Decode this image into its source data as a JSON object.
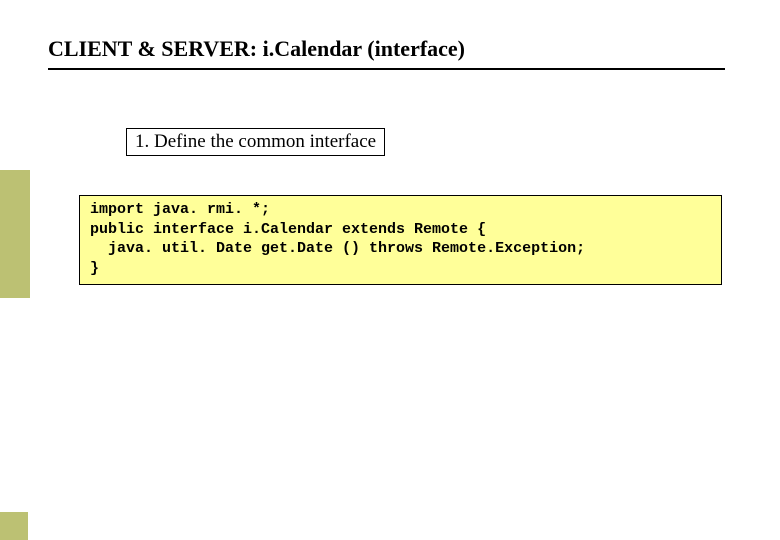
{
  "title": "CLIENT & SERVER: i.Calendar (interface)",
  "step": {
    "label": "1. Define the common interface"
  },
  "code": {
    "line1": "import java. rmi. *;",
    "line2": "public interface i.Calendar extends Remote {",
    "line3": "  java. util. Date get.Date () throws Remote.Exception;",
    "line4": "}"
  }
}
